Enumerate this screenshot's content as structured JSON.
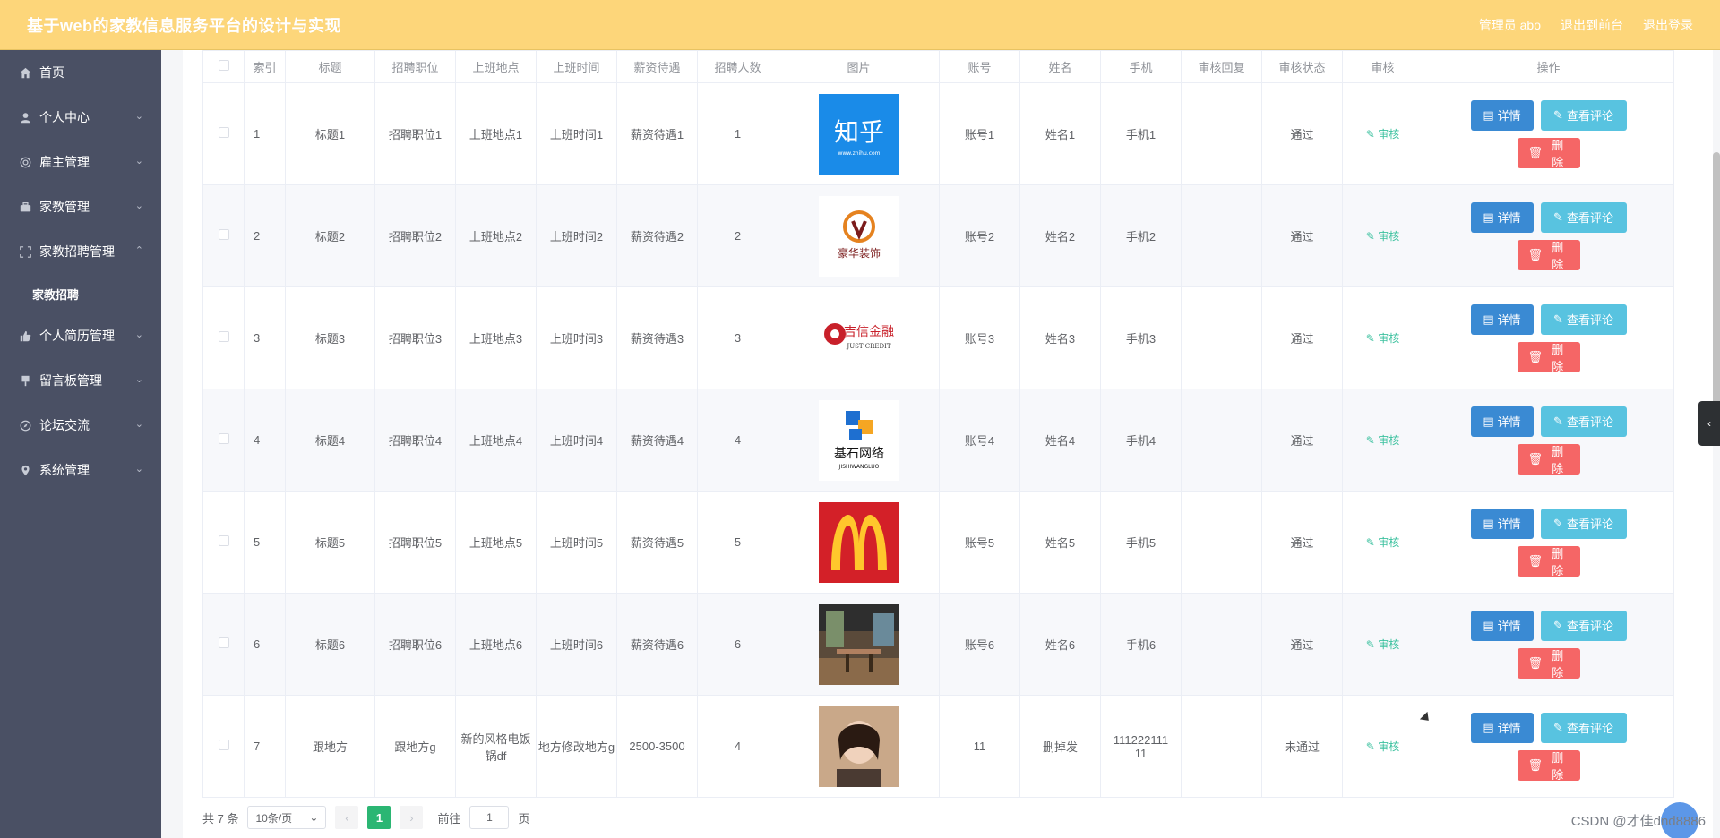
{
  "header": {
    "title": "基于web的家教信息服务平台的设计与实现",
    "admin_label": "管理员 abo",
    "to_front_label": "退出到前台",
    "logout_label": "退出登录"
  },
  "sidebar": {
    "items": [
      {
        "label": "首页",
        "icon": "home-icon",
        "expanded": false,
        "has_children": false
      },
      {
        "label": "个人中心",
        "icon": "user-icon",
        "has_children": true
      },
      {
        "label": "雇主管理",
        "icon": "target-icon",
        "has_children": true
      },
      {
        "label": "家教管理",
        "icon": "briefcase-icon",
        "has_children": true
      },
      {
        "label": "家教招聘管理",
        "icon": "expand-icon",
        "has_children": true,
        "expanded": true
      },
      {
        "label": "个人简历管理",
        "icon": "thumb-icon",
        "has_children": true
      },
      {
        "label": "留言板管理",
        "icon": "pin-icon",
        "has_children": true
      },
      {
        "label": "论坛交流",
        "icon": "compass-icon",
        "has_children": true
      },
      {
        "label": "系统管理",
        "icon": "location-icon",
        "has_children": true
      }
    ],
    "submenu": {
      "label": "家教招聘"
    }
  },
  "table": {
    "columns": [
      "",
      "索引",
      "标题",
      "招聘职位",
      "上班地点",
      "上班时间",
      "薪资待遇",
      "招聘人数",
      "图片",
      "账号",
      "姓名",
      "手机",
      "审核回复",
      "审核状态",
      "审核",
      "操作"
    ],
    "review_link": "审核",
    "buttons": {
      "detail": "详情",
      "comment": "查看评论",
      "delete": "删除"
    },
    "rows": [
      {
        "index": "1",
        "title": "标题1",
        "position": "招聘职位1",
        "location": "上班地点1",
        "time": "上班时间1",
        "salary": "薪资待遇1",
        "count": "1",
        "image": "zhihu-logo",
        "account": "账号1",
        "name": "姓名1",
        "phone": "手机1",
        "reply": "",
        "status": "通过"
      },
      {
        "index": "2",
        "title": "标题2",
        "position": "招聘职位2",
        "location": "上班地点2",
        "time": "上班时间2",
        "salary": "薪资待遇2",
        "count": "2",
        "image": "decoration-logo",
        "account": "账号2",
        "name": "姓名2",
        "phone": "手机2",
        "reply": "",
        "status": "通过"
      },
      {
        "index": "3",
        "title": "标题3",
        "position": "招聘职位3",
        "location": "上班地点3",
        "time": "上班时间3",
        "salary": "薪资待遇3",
        "count": "3",
        "image": "jixin-finance-logo",
        "account": "账号3",
        "name": "姓名3",
        "phone": "手机3",
        "reply": "",
        "status": "通过"
      },
      {
        "index": "4",
        "title": "标题4",
        "position": "招聘职位4",
        "location": "上班地点4",
        "time": "上班时间4",
        "salary": "薪资待遇4",
        "count": "4",
        "image": "jishi-network-logo",
        "account": "账号4",
        "name": "姓名4",
        "phone": "手机4",
        "reply": "",
        "status": "通过"
      },
      {
        "index": "5",
        "title": "标题5",
        "position": "招聘职位5",
        "location": "上班地点5",
        "time": "上班时间5",
        "salary": "薪资待遇5",
        "count": "5",
        "image": "mcdonalds-logo",
        "account": "账号5",
        "name": "姓名5",
        "phone": "手机5",
        "reply": "",
        "status": "通过"
      },
      {
        "index": "6",
        "title": "标题6",
        "position": "招聘职位6",
        "location": "上班地点6",
        "time": "上班时间6",
        "salary": "薪资待遇6",
        "count": "6",
        "image": "interior-photo",
        "account": "账号6",
        "name": "姓名6",
        "phone": "手机6",
        "reply": "",
        "status": "通过"
      },
      {
        "index": "7",
        "title": "跟地方",
        "position": "跟地方g",
        "location": "新的风格电饭锅df",
        "time": "地方修改地方g",
        "salary": "2500-3500",
        "count": "4",
        "image": "portrait-photo",
        "account": "11",
        "name": "删掉发",
        "phone": "11122211111",
        "reply": "",
        "status": "未通过"
      }
    ]
  },
  "pagination": {
    "total": "共 7 条",
    "page_size": "10条/页",
    "current_page": "1",
    "goto_label": "前往",
    "goto_value": "1",
    "page_unit": "页"
  },
  "logo_texts": {
    "zhihu": "知乎",
    "zhihu_url": "www.zhihu.com",
    "deco": "豪华装饰",
    "jixin": "吉信金融",
    "jixin_en": "JUST CREDIT",
    "jishi": "基石网络",
    "jishi_en": "JISHIWANGLUO"
  },
  "watermark": "CSDN @才佳dnd8886",
  "colors": {
    "header_bg": "#fdd67a",
    "sidebar_bg": "#4a5064",
    "detail_btn": "#3a8ad3",
    "comment_btn": "#58c3e0",
    "delete_btn": "#f56666",
    "review_link": "#3ec2a0",
    "active_page": "#2bb673"
  }
}
